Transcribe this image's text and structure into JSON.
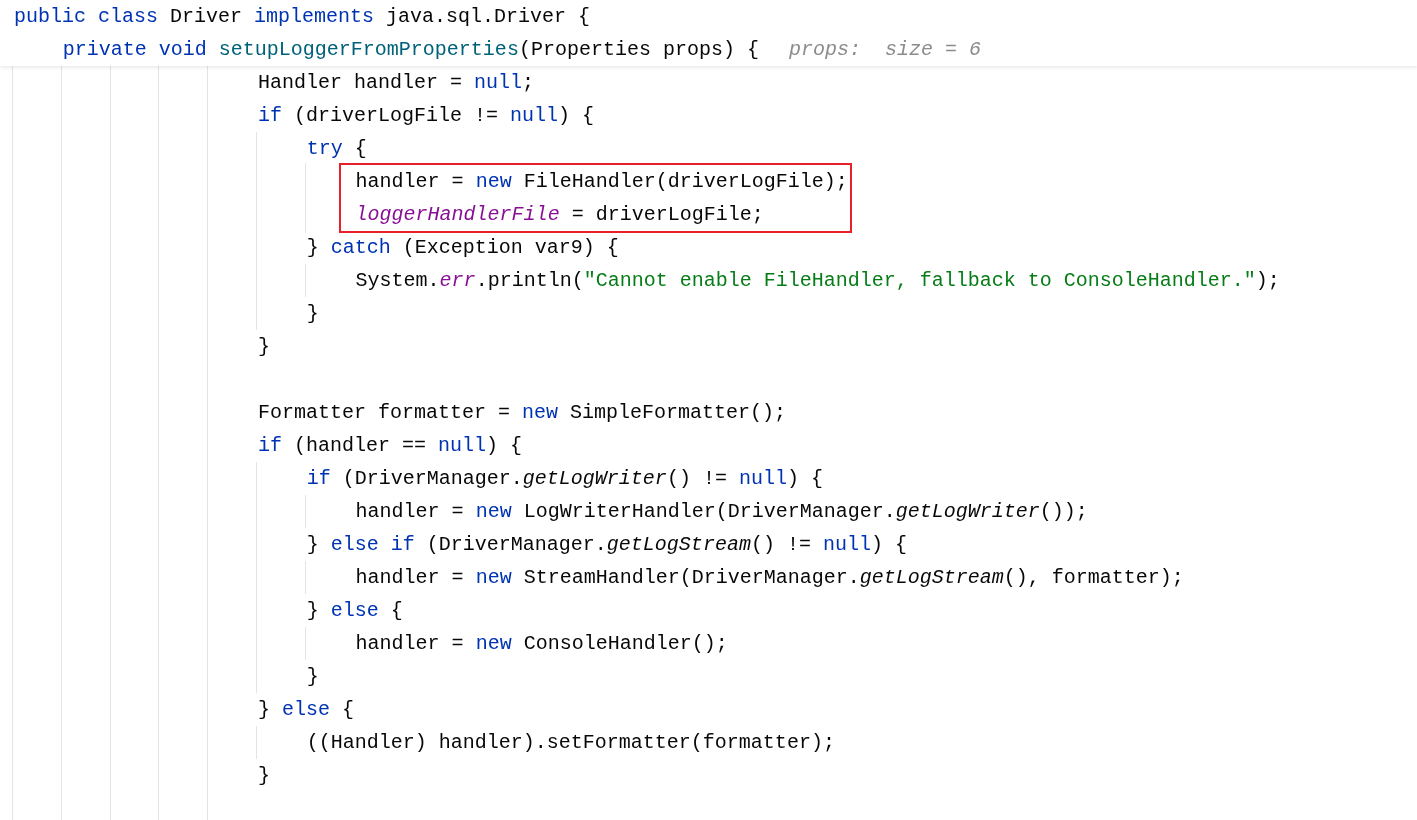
{
  "sticky_header": [
    {
      "tokens": [
        {
          "kind": "kw",
          "t": "public class "
        },
        {
          "kind": "plain",
          "t": "Driver "
        },
        {
          "kind": "kw",
          "t": "implements "
        },
        {
          "kind": "plain",
          "t": "java.sql.Driver {"
        }
      ],
      "children": [
        {
          "tokens": [
            {
              "kind": "kw",
              "t": "private void "
            },
            {
              "kind": "decl",
              "t": "setupLoggerFromProperties"
            },
            {
              "kind": "plain",
              "t": "(Properties props) {"
            }
          ],
          "inlay_hint": "props:  size = 6"
        }
      ]
    }
  ],
  "code_lines": [
    {
      "kind": "code",
      "tokens": [
        {
          "kind": "plain",
          "t": "Handler handler = "
        },
        {
          "kind": "kw",
          "t": "null"
        },
        {
          "kind": "plain",
          "t": ";"
        }
      ]
    },
    {
      "kind": "code",
      "tokens": [
        {
          "kind": "kw",
          "t": "if "
        },
        {
          "kind": "plain",
          "t": "(driverLogFile != "
        },
        {
          "kind": "kw",
          "t": "null"
        },
        {
          "kind": "plain",
          "t": ") {"
        }
      ],
      "children": [
        {
          "tokens": [
            {
              "kind": "kw",
              "t": "try "
            },
            {
              "kind": "plain",
              "t": "{"
            }
          ],
          "boxed_children": true,
          "children": [
            {
              "tokens": [
                {
                  "kind": "plain",
                  "t": "handler = "
                },
                {
                  "kind": "kw",
                  "t": "new "
                },
                {
                  "kind": "plain",
                  "t": "FileHandler(driverLogFile);"
                }
              ]
            },
            {
              "tokens": [
                {
                  "kind": "field",
                  "t": "loggerHandlerFile"
                },
                {
                  "kind": "plain",
                  "t": " = driverLogFile;"
                }
              ]
            }
          ]
        },
        {
          "tokens": [
            {
              "kind": "plain",
              "t": "} "
            },
            {
              "kind": "kw",
              "t": "catch "
            },
            {
              "kind": "plain",
              "t": "(Exception var9) {"
            }
          ],
          "children": [
            {
              "tokens": [
                {
                  "kind": "plain",
                  "t": "System."
                },
                {
                  "kind": "field",
                  "t": "err"
                },
                {
                  "kind": "plain",
                  "t": ".println("
                },
                {
                  "kind": "string",
                  "t": "\"Cannot enable FileHandler, fallback to ConsoleHandler.\""
                },
                {
                  "kind": "plain",
                  "t": ");"
                }
              ]
            }
          ]
        },
        {
          "tokens": [
            {
              "kind": "plain",
              "t": "}"
            }
          ]
        }
      ]
    },
    {
      "kind": "code",
      "tokens": [
        {
          "kind": "plain",
          "t": "}"
        }
      ]
    },
    {
      "kind": "blank"
    },
    {
      "kind": "code",
      "tokens": [
        {
          "kind": "plain",
          "t": "Formatter formatter = "
        },
        {
          "kind": "kw",
          "t": "new "
        },
        {
          "kind": "plain",
          "t": "SimpleFormatter();"
        }
      ]
    },
    {
      "kind": "code",
      "tokens": [
        {
          "kind": "kw",
          "t": "if "
        },
        {
          "kind": "plain",
          "t": "(handler == "
        },
        {
          "kind": "kw",
          "t": "null"
        },
        {
          "kind": "plain",
          "t": ") {"
        }
      ],
      "children": [
        {
          "tokens": [
            {
              "kind": "kw",
              "t": "if "
            },
            {
              "kind": "plain",
              "t": "(DriverManager."
            },
            {
              "kind": "static",
              "t": "getLogWriter"
            },
            {
              "kind": "plain",
              "t": "() != "
            },
            {
              "kind": "kw",
              "t": "null"
            },
            {
              "kind": "plain",
              "t": ") {"
            }
          ],
          "children": [
            {
              "tokens": [
                {
                  "kind": "plain",
                  "t": "handler = "
                },
                {
                  "kind": "kw",
                  "t": "new "
                },
                {
                  "kind": "plain",
                  "t": "LogWriterHandler(DriverManager."
                },
                {
                  "kind": "static",
                  "t": "getLogWriter"
                },
                {
                  "kind": "plain",
                  "t": "());"
                }
              ]
            }
          ]
        },
        {
          "tokens": [
            {
              "kind": "plain",
              "t": "} "
            },
            {
              "kind": "kw",
              "t": "else if "
            },
            {
              "kind": "plain",
              "t": "(DriverManager."
            },
            {
              "kind": "static",
              "t": "getLogStream"
            },
            {
              "kind": "plain",
              "t": "() != "
            },
            {
              "kind": "kw",
              "t": "null"
            },
            {
              "kind": "plain",
              "t": ") {"
            }
          ],
          "children": [
            {
              "tokens": [
                {
                  "kind": "plain",
                  "t": "handler = "
                },
                {
                  "kind": "kw",
                  "t": "new "
                },
                {
                  "kind": "plain",
                  "t": "StreamHandler(DriverManager."
                },
                {
                  "kind": "static",
                  "t": "getLogStream"
                },
                {
                  "kind": "plain",
                  "t": "(), formatter);"
                }
              ]
            }
          ]
        },
        {
          "tokens": [
            {
              "kind": "plain",
              "t": "} "
            },
            {
              "kind": "kw",
              "t": "else "
            },
            {
              "kind": "plain",
              "t": "{"
            }
          ],
          "children": [
            {
              "tokens": [
                {
                  "kind": "plain",
                  "t": "handler = "
                },
                {
                  "kind": "kw",
                  "t": "new "
                },
                {
                  "kind": "plain",
                  "t": "ConsoleHandler();"
                }
              ]
            }
          ]
        },
        {
          "tokens": [
            {
              "kind": "plain",
              "t": "}"
            }
          ]
        }
      ]
    },
    {
      "kind": "code",
      "tokens": [
        {
          "kind": "plain",
          "t": "} "
        },
        {
          "kind": "kw",
          "t": "else "
        },
        {
          "kind": "plain",
          "t": "{"
        }
      ],
      "children": [
        {
          "tokens": [
            {
              "kind": "plain",
              "t": "((Handler) handler).setFormatter(formatter);"
            }
          ]
        }
      ]
    },
    {
      "kind": "code",
      "tokens": [
        {
          "kind": "plain",
          "t": "}"
        }
      ]
    }
  ]
}
